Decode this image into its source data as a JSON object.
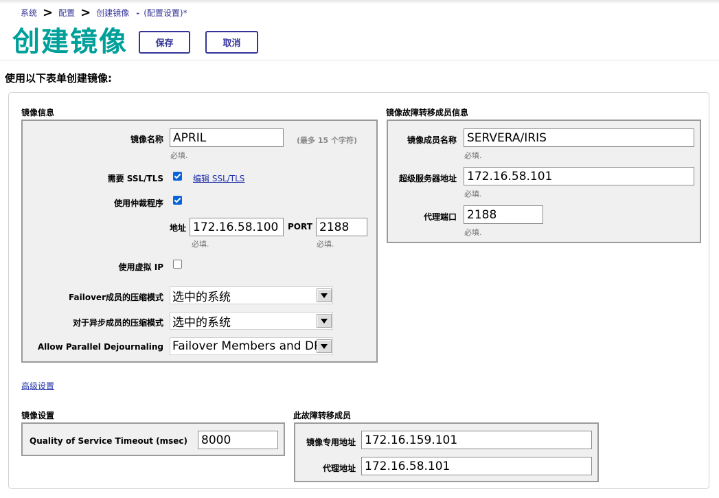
{
  "breadcrumb": {
    "items": [
      "系统",
      "配置",
      "创建镜像"
    ],
    "separator": ">",
    "dash": "-",
    "suffix": "(配置设置)*"
  },
  "page_title": "创建镜像",
  "buttons": {
    "save": "保存",
    "cancel": "取消"
  },
  "intro": "使用以下表单创建镜像:",
  "mirror_info": {
    "section_label": "镜像信息",
    "mirror_name": {
      "label": "镜像名称",
      "value": "APRIL",
      "hint": "(最多 15 个字符)",
      "required": "必填."
    },
    "ssl": {
      "label": "需要 SSL/TLS",
      "checked": true,
      "edit_link": "编辑 SSL/TLS"
    },
    "arbiter": {
      "label": "使用仲裁程序",
      "checked": true
    },
    "arbiter_address": {
      "label": "地址",
      "value": "172.16.58.100",
      "required": "必填."
    },
    "arbiter_port": {
      "label": "PORT",
      "value": "2188",
      "required": "必填."
    },
    "virtual_ip": {
      "label": "使用虚拟 IP",
      "checked": false
    },
    "failover_compression": {
      "label": "Failover成员的压缩模式",
      "value": "选中的系统"
    },
    "async_compression": {
      "label": "对于异步成员的压缩模式",
      "value": "选中的系统"
    },
    "parallel_dejournaling": {
      "label": "Allow Parallel Dejournaling",
      "value": "Failover Members and DR"
    }
  },
  "failover_member_info": {
    "section_label": "镜像故障转移成员信息",
    "member_name": {
      "label": "镜像成员名称",
      "value": "SERVERA/IRIS",
      "required": "必填."
    },
    "superserver_address": {
      "label": "超级服务器地址",
      "value": "172.16.58.101",
      "required": "必填."
    },
    "agent_port": {
      "label": "代理端口",
      "value": "2188",
      "required": "必填."
    }
  },
  "advanced_link": "高级设置",
  "mirror_settings": {
    "section_label": "镜像设置",
    "qos_timeout": {
      "label": "Quality of Service Timeout (msec)",
      "value": "8000"
    }
  },
  "this_failover_member": {
    "section_label": "此故障转移成员",
    "mirror_private_address": {
      "label": "镜像专用地址",
      "value": "172.16.159.101"
    },
    "agent_address": {
      "label": "代理地址",
      "value": "172.16.58.101"
    }
  }
}
